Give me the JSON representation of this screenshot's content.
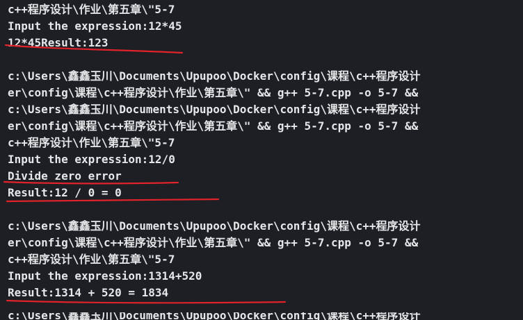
{
  "terminal": {
    "lines": [
      "c++程序设计\\作业\\第五章\\\"5-7",
      "Input the expression:12*45",
      "12*45Result:123",
      "",
      "c:\\Users\\鑫鑫玉川\\Documents\\Upupoo\\Docker\\config\\课程\\c++程序设计",
      "er\\config\\课程\\c++程序设计\\作业\\第五章\\\" && g++ 5-7.cpp -o 5-7 &&",
      "c:\\Users\\鑫鑫玉川\\Documents\\Upupoo\\Docker\\config\\课程\\c++程序设计",
      "er\\config\\课程\\c++程序设计\\作业\\第五章\\\" && g++ 5-7.cpp -o 5-7 &&",
      "c++程序设计\\作业\\第五章\\\"5-7",
      "Input the expression:12/0",
      "Divide zero error",
      "Result:12 / 0 = 0",
      "",
      "c:\\Users\\鑫鑫玉川\\Documents\\Upupoo\\Docker\\config\\课程\\c++程序设计",
      "er\\config\\课程\\c++程序设计\\作业\\第五章\\\" && g++ 5-7.cpp -o 5-7 &&",
      "c++程序设计\\作业\\第五章\\\"5-7",
      "Input the expression:1314+520",
      "Result:1314 + 520 = 1834",
      "",
      "c:\\Users\\鑫鑫玉川\\Documents\\Upupoo\\Docker\\config\\课程\\c++程序设计"
    ]
  },
  "colors": {
    "background": "#1e1f24",
    "text": "#e6e7e9",
    "annotation": "#e0232a"
  }
}
